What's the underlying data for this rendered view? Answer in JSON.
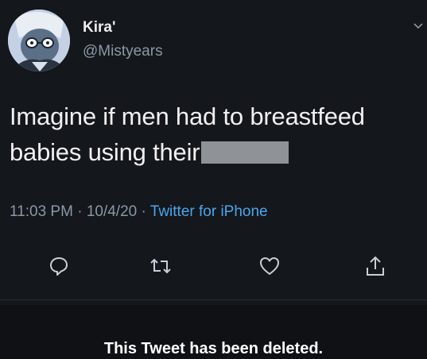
{
  "tweet": {
    "display_name": "Kira'",
    "handle": "@Mistyears",
    "text_line1": "Imagine if men had to breastfeed",
    "text_line2": "babies using their",
    "time": "11:03 PM",
    "date": "10/4/20",
    "separator": "·",
    "source": "Twitter for iPhone"
  },
  "actions": {
    "reply_icon": "reply-icon",
    "retweet_icon": "retweet-icon",
    "like_icon": "heart-icon",
    "share_icon": "share-icon"
  },
  "banner": {
    "text": "This Tweet has been deleted."
  },
  "colors": {
    "background": "#14171b",
    "text": "#eef0f2",
    "muted": "#8b98a5",
    "link": "#4aa6ee"
  }
}
